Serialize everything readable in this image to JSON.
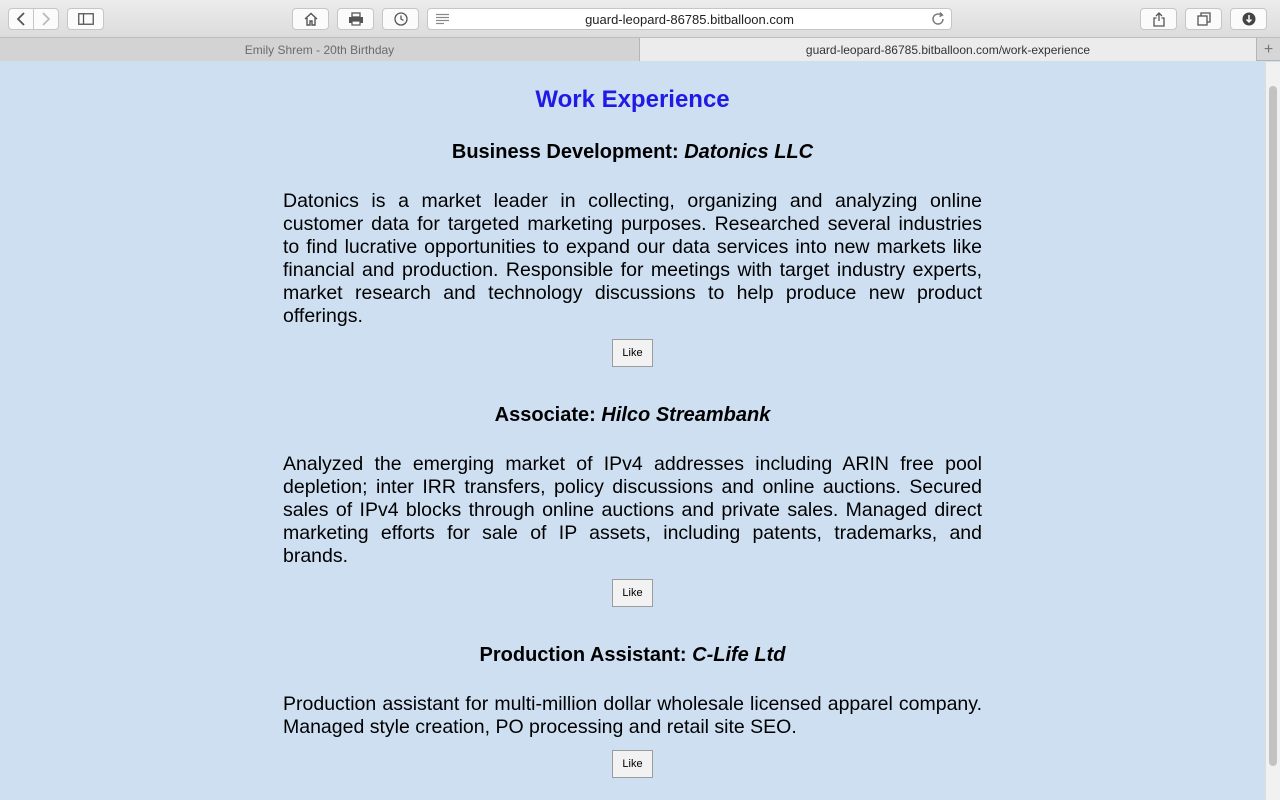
{
  "browser": {
    "address_url": "guard-leopard-86785.bitballoon.com",
    "tabs": [
      {
        "label": "Emily Shrem - 20th Birthday",
        "active": false
      },
      {
        "label": "guard-leopard-86785.bitballoon.com/work-experience",
        "active": true
      }
    ],
    "icons": [
      "back-icon",
      "forward-icon",
      "sidebar-icon",
      "home-icon",
      "print-icon",
      "history-icon",
      "reader-icon",
      "reload-icon",
      "share-icon",
      "tabs-overview-icon",
      "downloads-icon",
      "new-tab-icon"
    ]
  },
  "page": {
    "title": "Work Experience",
    "title_color": "#1f1ae6",
    "background": "#cddff1",
    "jobs": [
      {
        "role": "Business Development: ",
        "company": "Datonics LLC",
        "description": "Datonics is a market leader in collecting, organizing and analyzing online customer data for targeted marketing purposes. Researched several industries to find lucrative opportunities to expand our data services into new markets like financial and production. Responsible for meetings with target industry experts, market research and technology discussions to help produce new product offerings.",
        "like_label": "Like"
      },
      {
        "role": "Associate: ",
        "company": "Hilco Streambank",
        "description": "Analyzed the emerging market of IPv4 addresses including ARIN free pool depletion; inter IRR transfers, policy discussions and online auctions. Secured sales of IPv4 blocks through online auctions and private sales. Managed direct marketing efforts for sale of IP assets, including patents, trademarks, and brands.",
        "like_label": "Like"
      },
      {
        "role": "Production Assistant: ",
        "company": "C-Life Ltd",
        "description": "Production assistant for multi-million dollar wholesale licensed apparel company. Managed style creation, PO processing and retail site SEO.",
        "like_label": "Like"
      }
    ]
  }
}
